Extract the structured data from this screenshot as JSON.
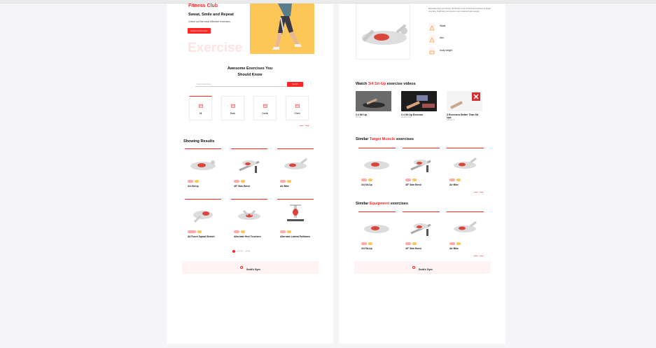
{
  "hero": {
    "brand": "Fitness Club",
    "headline": "Sweat, Smile and Repeat",
    "subtext": "Check out the most effective exercises",
    "cta": "Explore Exercises",
    "watermark": "Exercise"
  },
  "search": {
    "heading_line1": "Awesome Exercises You",
    "heading_line2": "Should Know",
    "placeholder": "Search Exercises",
    "button": "Search"
  },
  "categories": [
    {
      "label": "All",
      "icon": "gym-icon"
    },
    {
      "label": "Back",
      "icon": "gym-icon"
    },
    {
      "label": "Cardio",
      "icon": "gym-icon"
    },
    {
      "label": "Chest",
      "icon": "gym-icon"
    }
  ],
  "results": {
    "heading": "Showing Results",
    "items": [
      {
        "name": "3/4 Sit-Up",
        "tag1": "Waist",
        "tag2": "Abs"
      },
      {
        "name": "45° Side Bend",
        "tag1": "Waist",
        "tag2": "Abs"
      },
      {
        "name": "Air Bike",
        "tag1": "Waist",
        "tag2": "Abs"
      },
      {
        "name": "All Fours Squad Stretch",
        "tag1": "Upper Legs",
        "tag2": "Quads"
      },
      {
        "name": "Alternate Heel Touchers",
        "tag1": "Waist",
        "tag2": "Abs"
      },
      {
        "name": "Alternate Lateral Pulldown",
        "tag1": "Back",
        "tag2": "Lats"
      }
    ],
    "pagination": [
      "1",
      "2",
      "3",
      "4",
      "5",
      "...",
      "14",
      "15"
    ]
  },
  "footer": {
    "logo_text": "Gold's Gym"
  },
  "detail": {
    "description": "Exercises keep you strong. 3/4 Sit-Up is one of the best exercises to target your abs. It will help you improve your mood and gain energy.",
    "attributes": [
      {
        "label": "Waist",
        "icon": "body-part-icon"
      },
      {
        "label": "Abs",
        "icon": "target-icon"
      },
      {
        "label": "body weight",
        "icon": "equipment-icon"
      }
    ]
  },
  "videos": {
    "heading_prefix": "Watch ",
    "heading_name": "3/4 Sit-Up",
    "heading_suffix": " exercise videos",
    "items": [
      {
        "title": "3 4 Sit Up",
        "channel": "Fit Life"
      },
      {
        "title": "3 4 Sit Up Exercise",
        "channel": "Muscle Tube"
      },
      {
        "title": "3 Exercises Better Than Sit Ups",
        "channel": "Athlean-X"
      }
    ]
  },
  "similar_target": {
    "heading_prefix": "Similar ",
    "heading_highlight": "Target Muscle",
    "heading_suffix": " exercises",
    "items": [
      {
        "name": "3/4 Sit-Up"
      },
      {
        "name": "45° Side Bend"
      },
      {
        "name": "Air Bike"
      }
    ]
  },
  "similar_equipment": {
    "heading_prefix": "Similar ",
    "heading_highlight": "Equipment",
    "heading_suffix": " exercises",
    "items": [
      {
        "name": "3/4 Sit-Up"
      },
      {
        "name": "45° Side Bend"
      },
      {
        "name": "Air Bike"
      }
    ]
  },
  "colors": {
    "accent": "#ff2625",
    "hero_yellow": "#fcc757",
    "pill_pink": "#ffa9a9",
    "footer_bg": "#fff3f4"
  }
}
